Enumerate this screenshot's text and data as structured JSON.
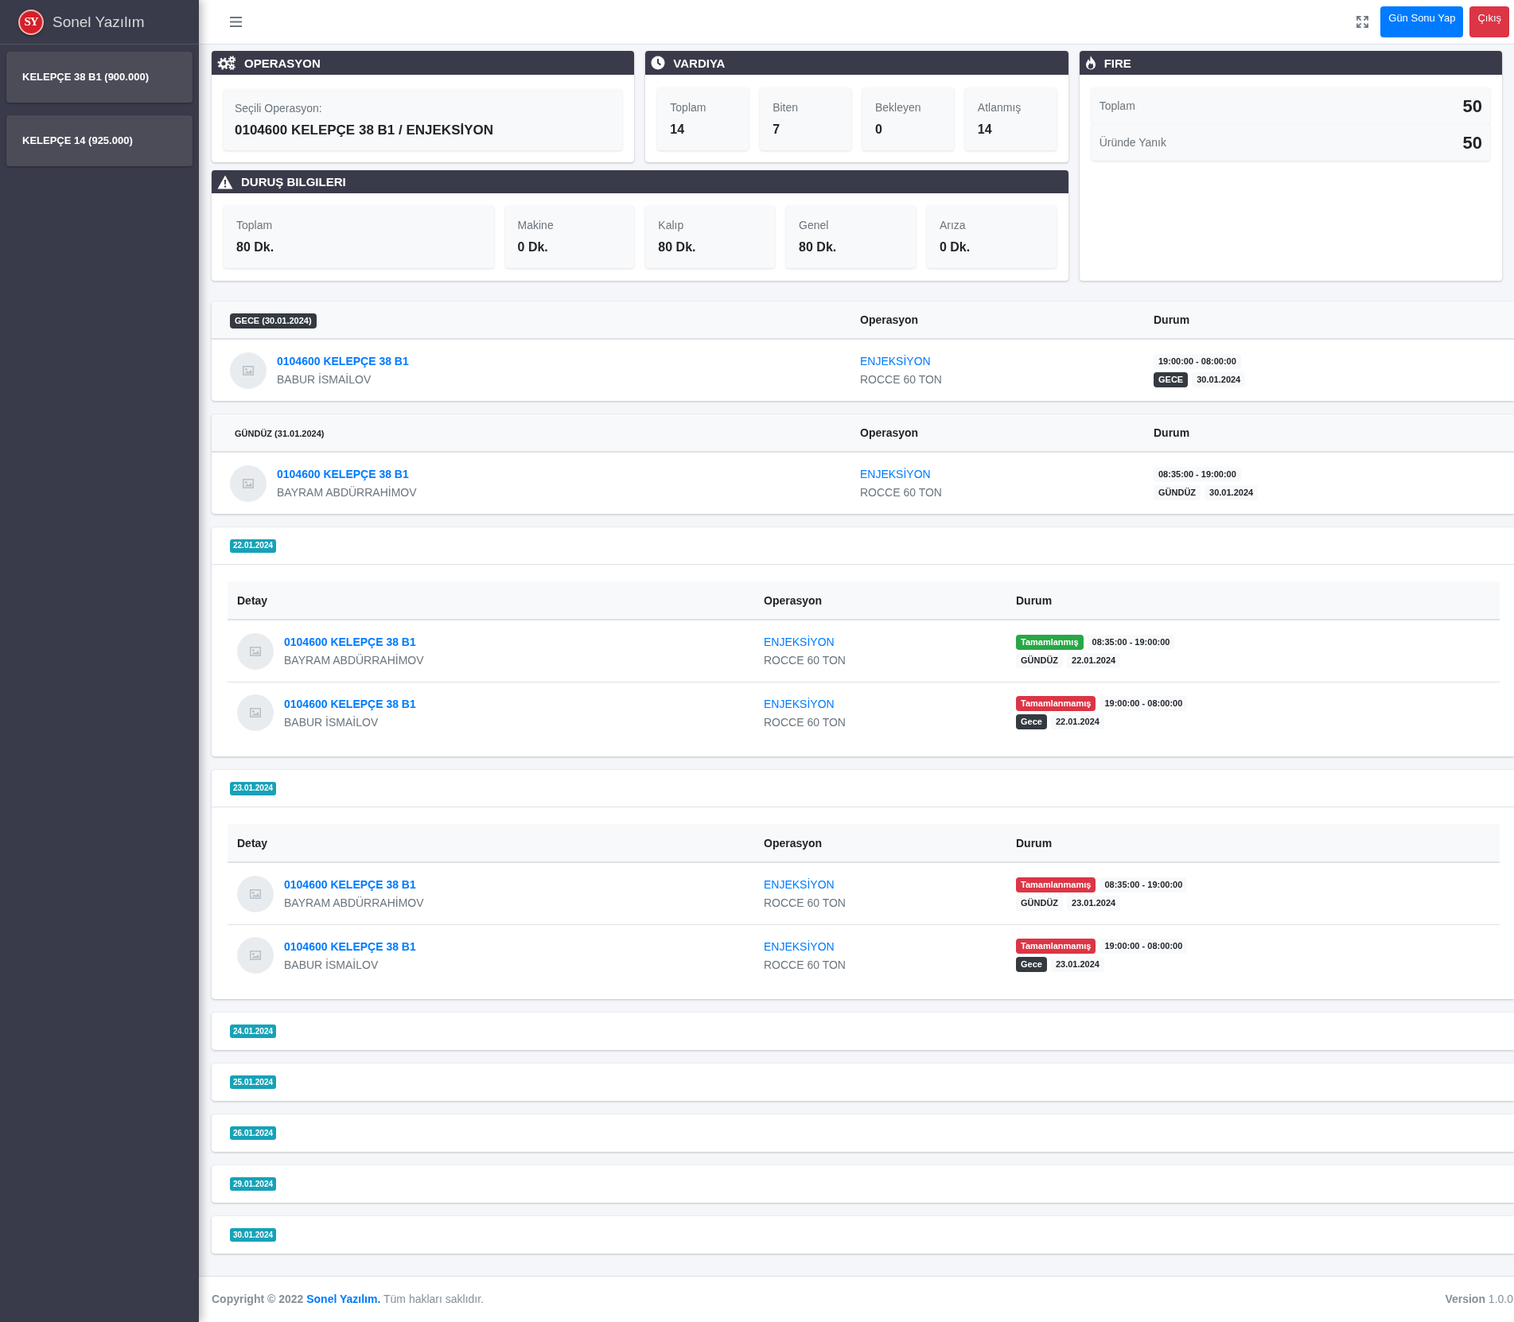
{
  "sidebar": {
    "brand": {
      "logo": "SY",
      "name": "Sonel Yazılım"
    },
    "items": [
      {
        "label": "KELEPÇE 38 B1 (900.000)",
        "selected": false
      },
      {
        "label": "KELEPÇE 14 (925.000)",
        "selected": false
      }
    ]
  },
  "topbar": {
    "buttons": [
      {
        "label": "Gün Sonu Yap",
        "kind": "primary"
      },
      {
        "label": "Çıkış",
        "kind": "danger"
      }
    ]
  },
  "operation_card": {
    "title": "OPERASYON",
    "label": "Seçili Operasyon:",
    "value": "0104600 KELEPÇE 38 B1 / ENJEKSİYON"
  },
  "shift_card": {
    "title": "VARDIYA",
    "stats": [
      {
        "label": "Toplam",
        "value": "14"
      },
      {
        "label": "Biten",
        "value": "7"
      },
      {
        "label": "Bekleyen",
        "value": "0"
      },
      {
        "label": "Atlanmış",
        "value": "14"
      }
    ]
  },
  "fire_card": {
    "title": "FIRE",
    "stats": [
      {
        "label": "Toplam",
        "value": "50"
      },
      {
        "label": "Üründe Yanık",
        "value": "50"
      }
    ]
  },
  "downtime_card": {
    "title": "DURUŞ BILGILERI",
    "stats": [
      {
        "label": "Toplam",
        "value": "80 Dk."
      },
      {
        "label": "Makine",
        "value": "0 Dk."
      },
      {
        "label": "Kalıp",
        "value": "80 Dk."
      },
      {
        "label": "Genel",
        "value": "80 Dk."
      },
      {
        "label": "Arıza",
        "value": "0 Dk."
      }
    ]
  },
  "shifts": [
    {
      "badge": {
        "text": "GECE (30.01.2024)",
        "color": "#343a40"
      },
      "columns": [
        "Operasyon",
        "Durum"
      ],
      "rows": [
        {
          "product": "0104600 KELEPÇE 38 B1",
          "operator": "BABUR İSMAİLOV",
          "operation": "ENJEKSİYON",
          "machine": "ROCCE 60 TON",
          "time": "19:00:00 - 08:00:00",
          "shift": {
            "text": "GECE",
            "color": "#343a40"
          },
          "date": "30.01.2024"
        }
      ]
    },
    {
      "badge": {
        "text": "GÜNDÜZ (31.01.2024)",
        "color": "#f8f9fa"
      },
      "columns": [
        "Operasyon",
        "Durum"
      ],
      "rows": [
        {
          "product": "0104600 KELEPÇE 38 B1",
          "operator": "BAYRAM ABDÜRRAHİMOV",
          "operation": "ENJEKSİYON",
          "machine": "ROCCE 60 TON",
          "time": "08:35:00 - 19:00:00",
          "shift": {
            "text": "GÜNDÜZ",
            "color": "#f8f9fa"
          },
          "date": "30.01.2024"
        }
      ]
    }
  ],
  "days": [
    {
      "date": "22.01.2024",
      "columns": [
        "Detay",
        "Operasyon",
        "Durum"
      ],
      "rows": [
        {
          "product": "0104600 KELEPÇE 38 B1",
          "operator": "BAYRAM ABDÜRRAHİMOV",
          "operation": "ENJEKSİYON",
          "machine": "ROCCE 60 TON",
          "status": {
            "text": "Tamamlanmış",
            "color": "#28a745"
          },
          "time": "08:35:00 - 19:00:00",
          "shift": {
            "text": "GÜNDÜZ",
            "color": "#f8f9fa"
          },
          "date": "22.01.2024"
        },
        {
          "product": "0104600 KELEPÇE 38 B1",
          "operator": "BABUR İSMAİLOV",
          "operation": "ENJEKSİYON",
          "machine": "ROCCE 60 TON",
          "status": {
            "text": "Tamamlanmamış",
            "color": "#dc3545"
          },
          "time": "19:00:00 - 08:00:00",
          "shift": {
            "text": "Gece",
            "color": "#343a40"
          },
          "date": "22.01.2024"
        }
      ]
    },
    {
      "date": "23.01.2024",
      "columns": [
        "Detay",
        "Operasyon",
        "Durum"
      ],
      "rows": [
        {
          "product": "0104600 KELEPÇE 38 B1",
          "operator": "BAYRAM ABDÜRRAHİMOV",
          "operation": "ENJEKSİYON",
          "machine": "ROCCE 60 TON",
          "status": {
            "text": "Tamamlanmamış",
            "color": "#dc3545"
          },
          "time": "08:35:00 - 19:00:00",
          "shift": {
            "text": "GÜNDÜZ",
            "color": "#f8f9fa"
          },
          "date": "23.01.2024"
        },
        {
          "product": "0104600 KELEPÇE 38 B1",
          "operator": "BABUR İSMAİLOV",
          "operation": "ENJEKSİYON",
          "machine": "ROCCE 60 TON",
          "status": {
            "text": "Tamamlanmamış",
            "color": "#dc3545"
          },
          "time": "19:00:00 - 08:00:00",
          "shift": {
            "text": "Gece",
            "color": "#343a40"
          },
          "date": "23.01.2024"
        }
      ]
    },
    {
      "date": "24.01.2024"
    },
    {
      "date": "25.01.2024"
    },
    {
      "date": "26.01.2024"
    },
    {
      "date": "29.01.2024"
    },
    {
      "date": "30.01.2024"
    }
  ],
  "footer": {
    "copyright": {
      "prefix": "Copyright © 2022",
      "link": "Sonel Yazılım.",
      "suffix": "Tüm hakları saklıdır."
    },
    "version": "**Version** 1.0.0"
  }
}
